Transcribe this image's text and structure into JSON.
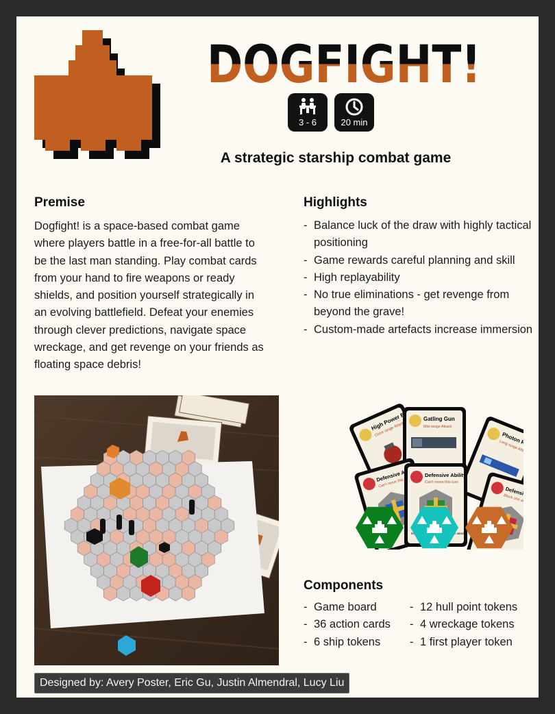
{
  "title": "DOGFIGHT!",
  "subtitle": "A strategic starship combat game",
  "badges": {
    "players": {
      "text": "3 - 6",
      "icon": "players-at-table-icon"
    },
    "time": {
      "text": "20 min",
      "icon": "clock-icon"
    }
  },
  "premise": {
    "heading": "Premise",
    "body": "Dogfight! is a space-based combat game where players battle in a free-for-all battle to be the last man standing. Play combat cards from your hand to fire weapons or ready shields, and position yourself strategically in an evolving battlefield. Defeat your enemies through clever predictions, navigate space wreckage, and get revenge on your friends as floating space debris!"
  },
  "highlights": {
    "heading": "Highlights",
    "items": [
      "Balance luck of the draw with highly tactical positioning",
      "Game rewards careful planning and skill",
      "High replayability",
      "No true eliminations - get revenge from beyond the grave!",
      "Custom-made artefacts increase immersion"
    ]
  },
  "cards": [
    {
      "title": "High Power Bomb",
      "subtitle": "Close range Attack",
      "note": ""
    },
    {
      "title": "Gatling Gun",
      "subtitle": "Mid-range Attack",
      "note": ""
    },
    {
      "title": "Photon Repeater",
      "subtitle": "Long range Attack",
      "note": ""
    },
    {
      "title": "Defensive Ability",
      "subtitle": "Can't move this turn",
      "note": ""
    },
    {
      "title": "Defensive Ability",
      "subtitle": "Can't move this turn",
      "note": "Don't take damage this turn. The attacker is allowed"
    },
    {
      "title": "Defensive Ability",
      "subtitle": "Block one attack this turn",
      "note": ""
    }
  ],
  "ship_tokens": [
    {
      "color": "#0a7f1d"
    },
    {
      "color": "#14c4bc"
    },
    {
      "color": "#c86a28"
    }
  ],
  "components": {
    "heading": "Components",
    "col1": [
      "Game board",
      "36 action cards",
      "6 ship tokens"
    ],
    "col2": [
      "12 hull point tokens",
      "4 wreckage tokens",
      "1 first player token"
    ]
  },
  "credits": "Designed by: Avery Poster, Eric Gu, Justin Almendral, Lucy Liu",
  "colors": {
    "brand_orange": "#c15f20",
    "ink": "#111111",
    "paper": "#fdfaf3"
  }
}
